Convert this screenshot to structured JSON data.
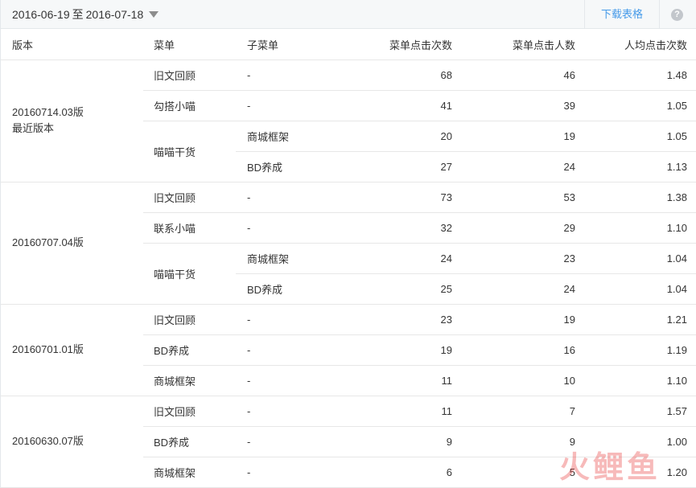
{
  "toolbar": {
    "date_start": "2016-06-19",
    "date_separator": "至",
    "date_end": "2016-07-18",
    "download_label": "下载表格",
    "help_glyph": "?"
  },
  "columns": {
    "version": "版本",
    "menu": "菜单",
    "submenu": "子菜单",
    "clicks": "菜单点击次数",
    "users": "菜单点击人数",
    "avg": "人均点击次数"
  },
  "groups": [
    {
      "version": "20160714.03版",
      "note": "最近版本",
      "menus": [
        {
          "name": "旧文回顾",
          "rows": [
            {
              "sub": "-",
              "clicks": "68",
              "users": "46",
              "avg": "1.48"
            }
          ]
        },
        {
          "name": "勾搭小喵",
          "rows": [
            {
              "sub": "-",
              "clicks": "41",
              "users": "39",
              "avg": "1.05"
            }
          ]
        },
        {
          "name": "喵喵干货",
          "rows": [
            {
              "sub": "商城框架",
              "clicks": "20",
              "users": "19",
              "avg": "1.05"
            },
            {
              "sub": "BD养成",
              "clicks": "27",
              "users": "24",
              "avg": "1.13"
            }
          ]
        }
      ]
    },
    {
      "version": "20160707.04版",
      "note": "",
      "menus": [
        {
          "name": "旧文回顾",
          "rows": [
            {
              "sub": "-",
              "clicks": "73",
              "users": "53",
              "avg": "1.38"
            }
          ]
        },
        {
          "name": "联系小喵",
          "rows": [
            {
              "sub": "-",
              "clicks": "32",
              "users": "29",
              "avg": "1.10"
            }
          ]
        },
        {
          "name": "喵喵干货",
          "rows": [
            {
              "sub": "商城框架",
              "clicks": "24",
              "users": "23",
              "avg": "1.04"
            },
            {
              "sub": "BD养成",
              "clicks": "25",
              "users": "24",
              "avg": "1.04"
            }
          ]
        }
      ]
    },
    {
      "version": "20160701.01版",
      "note": "",
      "menus": [
        {
          "name": "旧文回顾",
          "rows": [
            {
              "sub": "-",
              "clicks": "23",
              "users": "19",
              "avg": "1.21"
            }
          ]
        },
        {
          "name": "BD养成",
          "rows": [
            {
              "sub": "-",
              "clicks": "19",
              "users": "16",
              "avg": "1.19"
            }
          ]
        },
        {
          "name": "商城框架",
          "rows": [
            {
              "sub": "-",
              "clicks": "11",
              "users": "10",
              "avg": "1.10"
            }
          ]
        }
      ]
    },
    {
      "version": "20160630.07版",
      "note": "",
      "menus": [
        {
          "name": "旧文回顾",
          "rows": [
            {
              "sub": "-",
              "clicks": "11",
              "users": "7",
              "avg": "1.57"
            }
          ]
        },
        {
          "name": "BD养成",
          "rows": [
            {
              "sub": "-",
              "clicks": "9",
              "users": "9",
              "avg": "1.00"
            }
          ]
        },
        {
          "name": "商城框架",
          "rows": [
            {
              "sub": "-",
              "clicks": "6",
              "users": "5",
              "avg": "1.20"
            }
          ]
        }
      ]
    }
  ],
  "watermark": {
    "chars": [
      "火",
      "鲤",
      "鱼"
    ],
    "color": "#e83a3a"
  },
  "colors": {
    "accent_link": "#459ae9",
    "border": "#e7e7e7",
    "toolbar_bg": "#f6f8f9"
  }
}
